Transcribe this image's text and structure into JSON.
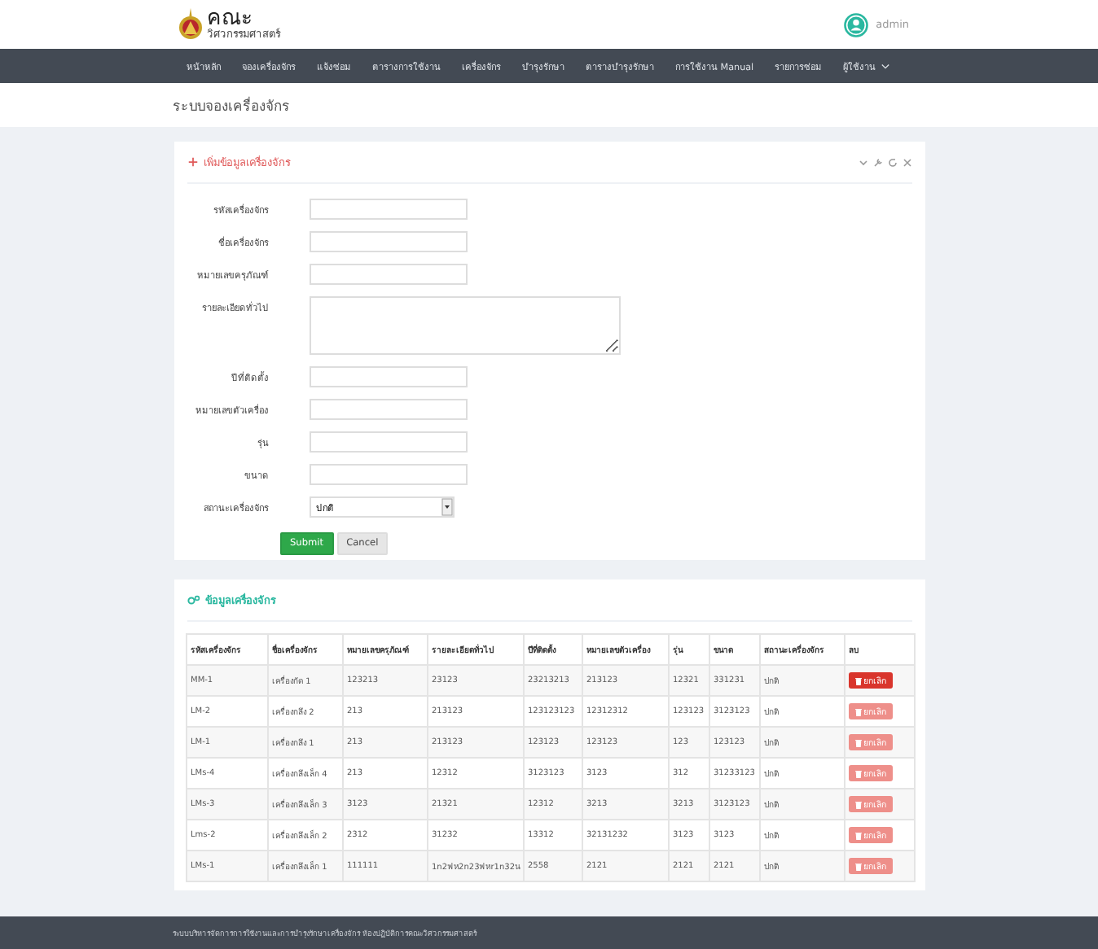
{
  "header": {
    "logo_title": "คณะ",
    "logo_subtitle": "วิศวกรรมศาสตร์",
    "user": "admin"
  },
  "nav": [
    {
      "label": "หน้าหลัก",
      "dropdown": false
    },
    {
      "label": "จองเครื่องจักร",
      "dropdown": false
    },
    {
      "label": "แจ้งซ่อม",
      "dropdown": false
    },
    {
      "label": "ตารางการใช้งาน",
      "dropdown": false
    },
    {
      "label": "เครื่องจักร",
      "dropdown": false
    },
    {
      "label": "บำรุงรักษา",
      "dropdown": false
    },
    {
      "label": "ตารางบำรุงรักษา",
      "dropdown": false
    },
    {
      "label": "การใช้งาน Manual",
      "dropdown": false
    },
    {
      "label": "รายการซ่อม",
      "dropdown": false
    },
    {
      "label": "ผู้ใช้งาน",
      "dropdown": true
    }
  ],
  "page_title": "ระบบจองเครื่องจักร",
  "form_panel": {
    "title": "เพิ่มข้อมูลเครื่องจักร",
    "fields": [
      {
        "kind": "text",
        "label": "รหัสเครื่องจักร"
      },
      {
        "kind": "text",
        "label": "ชื่อเครื่องจักร"
      },
      {
        "kind": "text",
        "label": "หมายเลขครุภัณฑ์"
      },
      {
        "kind": "textarea",
        "label": "รายละเอียดทั่วไป"
      },
      {
        "kind": "text",
        "label": "ปีที่ติดตั้ง"
      },
      {
        "kind": "text",
        "label": "หมายเลขตัวเครื่อง"
      },
      {
        "kind": "text",
        "label": "รุ่น"
      },
      {
        "kind": "text",
        "label": "ขนาด"
      },
      {
        "kind": "select",
        "label": "สถานะเครื่องจักร",
        "value": "ปกติ"
      }
    ],
    "buttons": [
      {
        "kind": "primary",
        "label": "Submit"
      },
      {
        "kind": "default",
        "label": "Cancel"
      }
    ]
  },
  "table_panel": {
    "title": "ข้อมูลเครื่องจักร",
    "columns": [
      "รหัสเครื่องจักร",
      "ชื่อเครื่องจักร",
      "หมายเลขครุภัณฑ์",
      "รายละเอียดทั่วไป",
      "ปีที่ติดตั้ง",
      "หมายเลขตัวเครื่อง",
      "รุ่น",
      "ขนาด",
      "สถานะเครื่องจักร",
      "ลบ"
    ],
    "rows": [
      {
        "cells": [
          "MM-1",
          "เครื่องกัด 1",
          "123213",
          "23123",
          "23213213",
          "213123",
          "12321",
          "331231",
          "ปกติ"
        ],
        "delete_label": "ยกเลิก",
        "delete_highlighted": true
      },
      {
        "cells": [
          "LM-2",
          "เครื่องกลึง 2",
          "213",
          "213123",
          "123123123",
          "12312312",
          "123123",
          "3123123",
          "ปกติ"
        ],
        "delete_label": "ยกเลิก",
        "delete_highlighted": false
      },
      {
        "cells": [
          "LM-1",
          "เครื่องกลึง 1",
          "213",
          "213123",
          "123123",
          "123123",
          "123",
          "123123",
          "ปกติ"
        ],
        "delete_label": "ยกเลิก",
        "delete_highlighted": false
      },
      {
        "cells": [
          "LMs-4",
          "เครื่องกลึงเล็ก 4",
          "213",
          "12312",
          "3123123",
          "3123",
          "312",
          "31233123",
          "ปกติ"
        ],
        "delete_label": "ยกเลิก",
        "delete_highlighted": false
      },
      {
        "cells": [
          "LMs-3",
          "เครื่องกลึงเล็ก 3",
          "3123",
          "21321",
          "12312",
          "3213",
          "3213",
          "3123123",
          "ปกติ"
        ],
        "delete_label": "ยกเลิก",
        "delete_highlighted": false
      },
      {
        "cells": [
          "Lms-2",
          "เครื่องกลึงเล็ก 2",
          "2312",
          "31232",
          "13312",
          "32131232",
          "3123",
          "3123",
          "ปกติ"
        ],
        "delete_label": "ยกเลิก",
        "delete_highlighted": false
      },
      {
        "cells": [
          "LMs-1",
          "เครื่องกลึงเล็ก 1",
          "111111",
          "1n2ฟห2n23ฟหr1n32น",
          "2558",
          "2121",
          "2121",
          "2121",
          "ปกติ"
        ],
        "delete_label": "ยกเลิก",
        "delete_highlighted": false
      }
    ]
  },
  "footer": "ระบบบริหารจัดการการใช้งานและการบำรุงรักษาเครื่องจักร ห้องปฏิบัติการคณะวิศวกรรมศาสตร์"
}
